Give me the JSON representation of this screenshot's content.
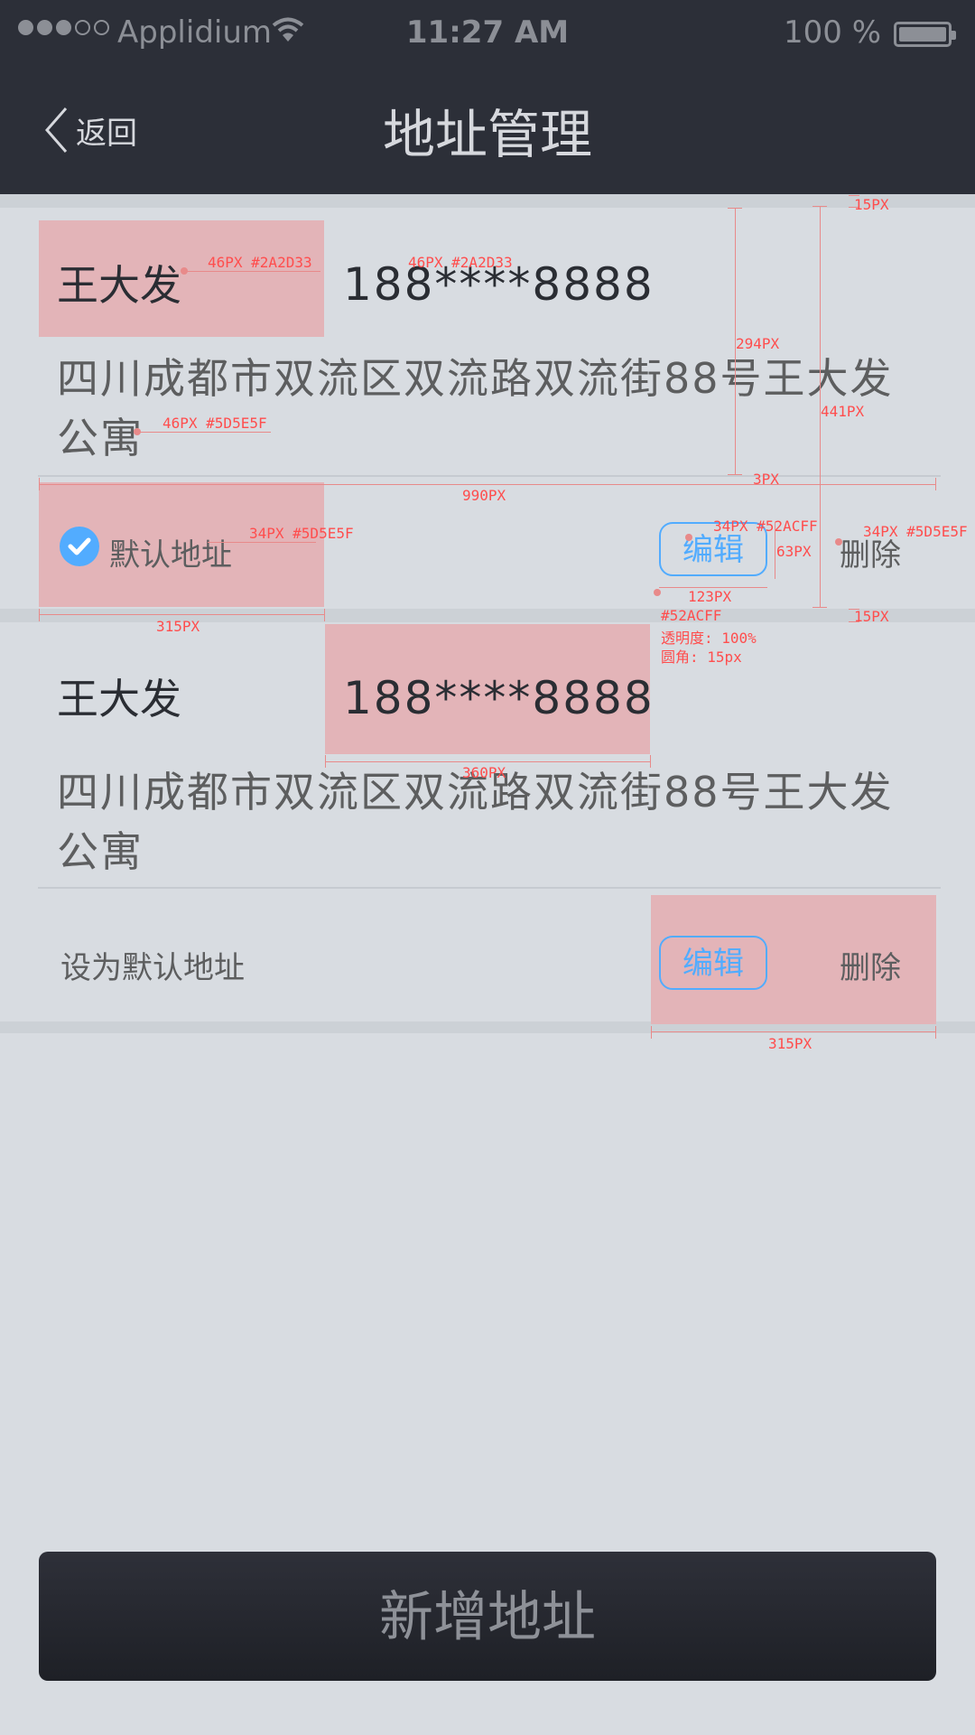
{
  "status_bar": {
    "carrier": "Applidium",
    "time": "11:27 AM",
    "battery_pct": "100 %"
  },
  "nav": {
    "back_label": "返回",
    "title": "地址管理"
  },
  "addresses": [
    {
      "name": "王大发",
      "phone": "188****8888",
      "address": "四川成都市双流区双流路双流街88号王大发公寓",
      "default_label": "默认地址",
      "is_default": true,
      "edit_label": "编辑",
      "delete_label": "删除"
    },
    {
      "name": "王大发",
      "phone": "188****8888",
      "address": "四川成都市双流区双流路双流街88号王大发公寓",
      "default_label": "设为默认地址",
      "is_default": false,
      "edit_label": "编辑",
      "delete_label": "删除"
    }
  ],
  "add_button_label": "新增地址",
  "colors": {
    "nav_bg": "#2c2f38",
    "page_bg": "#d8dce1",
    "name_text": "#2A2D33",
    "secondary_text": "#5D5E5F",
    "accent": "#52ACFF",
    "highlight": "#e3b4b8"
  },
  "annotations": {
    "name_spec": "46PX #2A2D33",
    "phone_spec": "46PX #2A2D33",
    "address_spec": "46PX #5D5E5F",
    "default_spec": "34PX #5D5E5F",
    "edit_spec": "34PX #52ACFF",
    "delete_spec": "34PX #5D5E5F",
    "top_gap": "15PX",
    "block_height": "294PX",
    "card_height": "441PX",
    "divider": "3PX",
    "row_width": "990PX",
    "left_width": "315PX",
    "edit_height": "63PX",
    "edit_width": "123PX",
    "bottom_gap": "15PX",
    "edit_color": "#52ACFF",
    "edit_opacity": "透明度: 100%",
    "edit_radius": "圆角: 15px",
    "phone_width": "360PX",
    "right_width": "315PX"
  }
}
